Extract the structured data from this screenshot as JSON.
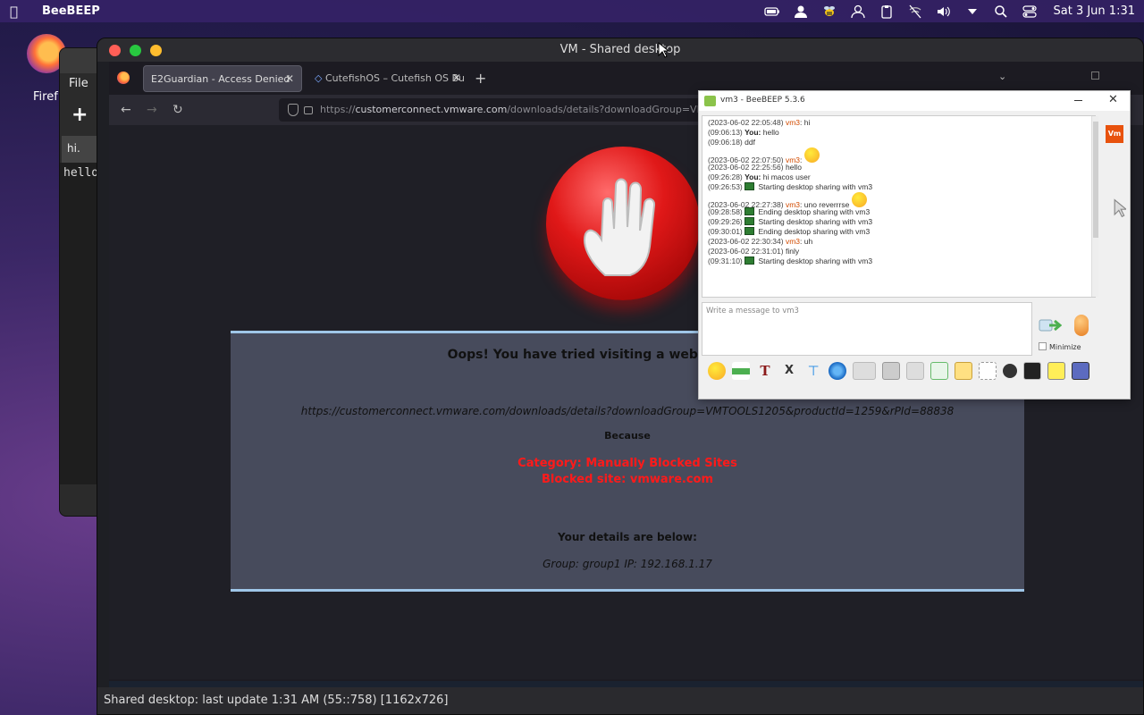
{
  "menubar": {
    "app_name": "BeeBEEP",
    "clock": "Sat 3 Jun  1:31"
  },
  "desktop": {
    "firefox_label": "Firef"
  },
  "editor": {
    "menu_file": "File",
    "tab_label": "hi.",
    "content": "hello"
  },
  "vm_window": {
    "title": "VM - Shared desktop",
    "status": "Shared desktop: last update 1:31 AM (55::758) [1162x726]"
  },
  "browser": {
    "tabs": [
      {
        "label": "E2Guardian - Access Denied",
        "active": true
      },
      {
        "label": "CutefishOS – Cutefish OS Bu ll",
        "active": false
      }
    ],
    "url_prefix": "https://",
    "url_domain": "customerconnect.vmware.com",
    "url_path": "/downloads/details?downloadGroup=VMTOOLS"
  },
  "block_page": {
    "heading": "Oops! You have tried visiting a website which has l",
    "blocked_url": "https://customerconnect.vmware.com/downloads/details?downloadGroup=VMTOOLS1205&productId=1259&rPId=88838",
    "because": "Because",
    "category": "Category: Manually Blocked Sites",
    "blocked_site": "Blocked site: vmware.com",
    "details_heading": "Your details are below:",
    "group_info": "Group: group1    IP: 192.168.1.17"
  },
  "chat": {
    "title": "vm3 - BeeBEEP 5.3.6",
    "side_badge": "Vm",
    "messages": [
      {
        "ts": "(2023-06-02 22:05:48)",
        "who": "vm3",
        "text": ": hi"
      },
      {
        "ts": "(09:06:13)",
        "you": "You:",
        "text": " hello"
      },
      {
        "ts": "(09:06:18)",
        "text": "    ddf"
      },
      {
        "ts": "(2023-06-02 22:07:50)",
        "who": "vm3",
        "text": ":",
        "smile": true
      },
      {
        "ts": "(2023-06-02 22:25:56)",
        "text": "    hello"
      },
      {
        "ts": "(09:26:28)",
        "you": "You:",
        "text": " hi macos user"
      },
      {
        "ts": "(09:26:53)",
        "icon": true,
        "text": " Starting desktop sharing with vm3"
      },
      {
        "ts": "(2023-06-02 22:27:38)",
        "who": "vm3",
        "text": ": uno reverrrse",
        "smile": true
      },
      {
        "ts": "(09:28:58)",
        "icon": true,
        "text": " Ending desktop sharing with vm3"
      },
      {
        "ts": "(09:29:26)",
        "icon": true,
        "text": " Starting desktop sharing with vm3"
      },
      {
        "ts": "(09:30:01)",
        "icon": true,
        "text": " Ending desktop sharing with vm3"
      },
      {
        "ts": "(2023-06-02 22:30:34)",
        "who": "vm3",
        "text": ": uh"
      },
      {
        "ts": "(2023-06-02 22:31:01)",
        "text": "    finly"
      },
      {
        "ts": "(09:31:10)",
        "icon": true,
        "text": " Starting desktop sharing with vm3"
      }
    ],
    "input_placeholder": "Write a message to vm3",
    "minimize_label": "Minimize"
  }
}
